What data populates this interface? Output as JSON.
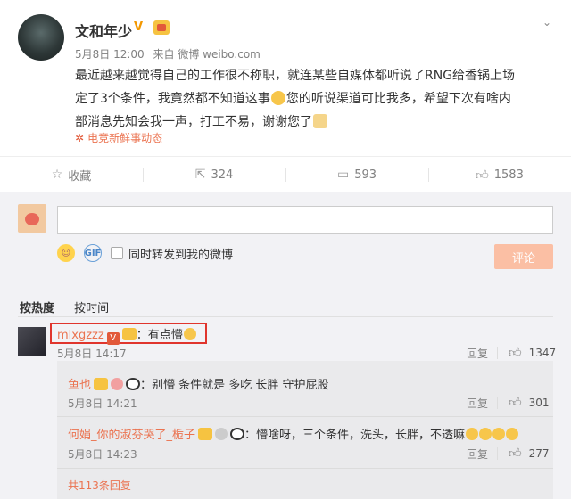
{
  "post": {
    "author": "文和年少",
    "verified_icon": "verified-v-icon",
    "date": "5月8日 12:00",
    "source": "来自 微博 weibo.com",
    "text_line1": "最近越来越觉得自己的工作很不称职，就连某些自媒体都听说了RNG给香锅上场",
    "text_line2_a": "定了3个条件，我竟然都不知道这事",
    "text_line2_b": "您的听说渠道可比我多，希望下次有啥内",
    "text_line3": "部消息先知会我一声，打工不易，谢谢您了",
    "topic": "电竞新鲜事动态"
  },
  "actions": {
    "favorite": "收藏",
    "repost_count": "324",
    "comment_count": "593",
    "like_count": "1583"
  },
  "composer": {
    "sync_label": "同时转发到我的微博",
    "submit_label": "评论"
  },
  "sort": {
    "by_hot": "按热度",
    "by_time": "按时间"
  },
  "comments": [
    {
      "user": "mlxgzzz",
      "text": "：有点懵",
      "time": "5月8日 14:17",
      "reply_label": "回复",
      "likes": "1347"
    }
  ],
  "replies": [
    {
      "user": "鱼也",
      "text": "：别懵 条件就是 多吃 长胖 守护屁股",
      "time": "5月8日 14:21",
      "reply_label": "回复",
      "likes": "301"
    },
    {
      "user": "何娟_你的淑芬哭了_栀子",
      "text": "：懵啥呀，三个条件，洗头，长胖，不透嘛",
      "time": "5月8日 14:23",
      "reply_label": "回复",
      "likes": "277"
    }
  ],
  "more_replies": "共113条回复",
  "colors": {
    "accent": "#eb7350",
    "highlight_box": "#e0352d",
    "submit_disabled": "#fbbfa4"
  }
}
